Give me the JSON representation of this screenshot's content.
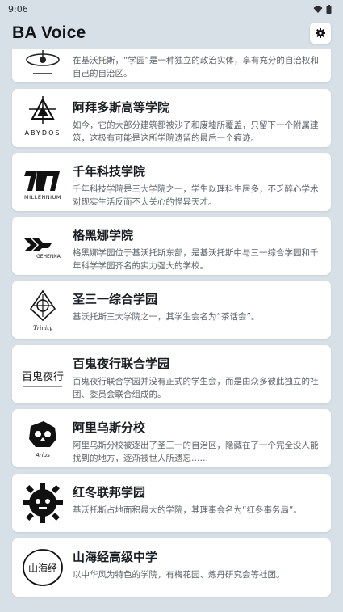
{
  "status_bar": {
    "time": "9:06",
    "wifi_icon": "wifi-icon",
    "battery_icon": "battery-icon"
  },
  "header": {
    "title": "BA Voice",
    "settings_icon": "settings-icon"
  },
  "schools": [
    {
      "name": "",
      "desc": "在基沃托斯，“学园”是一种独立的政治实体，享有充分的自治权和自己的自治区。",
      "logo_icon": "halo-emblem-icon",
      "logo_text": ""
    },
    {
      "name": "阿拜多斯高等学院",
      "desc": "如今，它的大部分建筑都被沙子和废墟所覆盖，只留下一个附属建筑，这极有可能是这所学院遗留的最后一个痕迹。",
      "logo_icon": "abydos-emblem-icon",
      "logo_text": "ABYDOS"
    },
    {
      "name": "千年科技学院",
      "desc": "千年科技学院是三大学院之一，学生以理科生居多，不乏醉心学术对现实生活反而不太关心的怪异天才。",
      "logo_icon": "millennium-emblem-icon",
      "logo_text": "MILLENNIUM"
    },
    {
      "name": "格黑娜学院",
      "desc": "格黑娜学园位于基沃托斯东部，是基沃托斯中与三一综合学园和千年科学学园齐名的实力强大的学校。",
      "logo_icon": "gehenna-emblem-icon",
      "logo_text": "GEHENNA"
    },
    {
      "name": "圣三一综合学园",
      "desc": "基沃托斯三大学院之一，其学生会名为“茶话会”。",
      "logo_icon": "trinity-emblem-icon",
      "logo_text": "Trinity"
    },
    {
      "name": "百鬼夜行联合学园",
      "desc": "百鬼夜行联合学园并没有正式的学生会，而是由众多彼此独立的社团、委员会联合组成的。",
      "logo_icon": "hyakkiyako-emblem-icon",
      "logo_text": "百鬼夜行"
    },
    {
      "name": "阿里乌斯分校",
      "desc": "阿里乌斯分校被逐出了圣三一的自治区，隐藏在了一个完全没人能找到的地方，逐渐被世人所遗忘……",
      "logo_icon": "arius-emblem-icon",
      "logo_text": "Arius"
    },
    {
      "name": "红冬联邦学园",
      "desc": "基沃托斯占地面积最大的学院，其理事会名为“红冬事务局”。",
      "logo_icon": "red-winter-emblem-icon",
      "logo_text": ""
    },
    {
      "name": "山海经高级中学",
      "desc": "以中华风为特色的学院，有梅花园、炼丹研究会等社团。",
      "logo_icon": "shanhaijing-emblem-icon",
      "logo_text": "山海经"
    }
  ]
}
